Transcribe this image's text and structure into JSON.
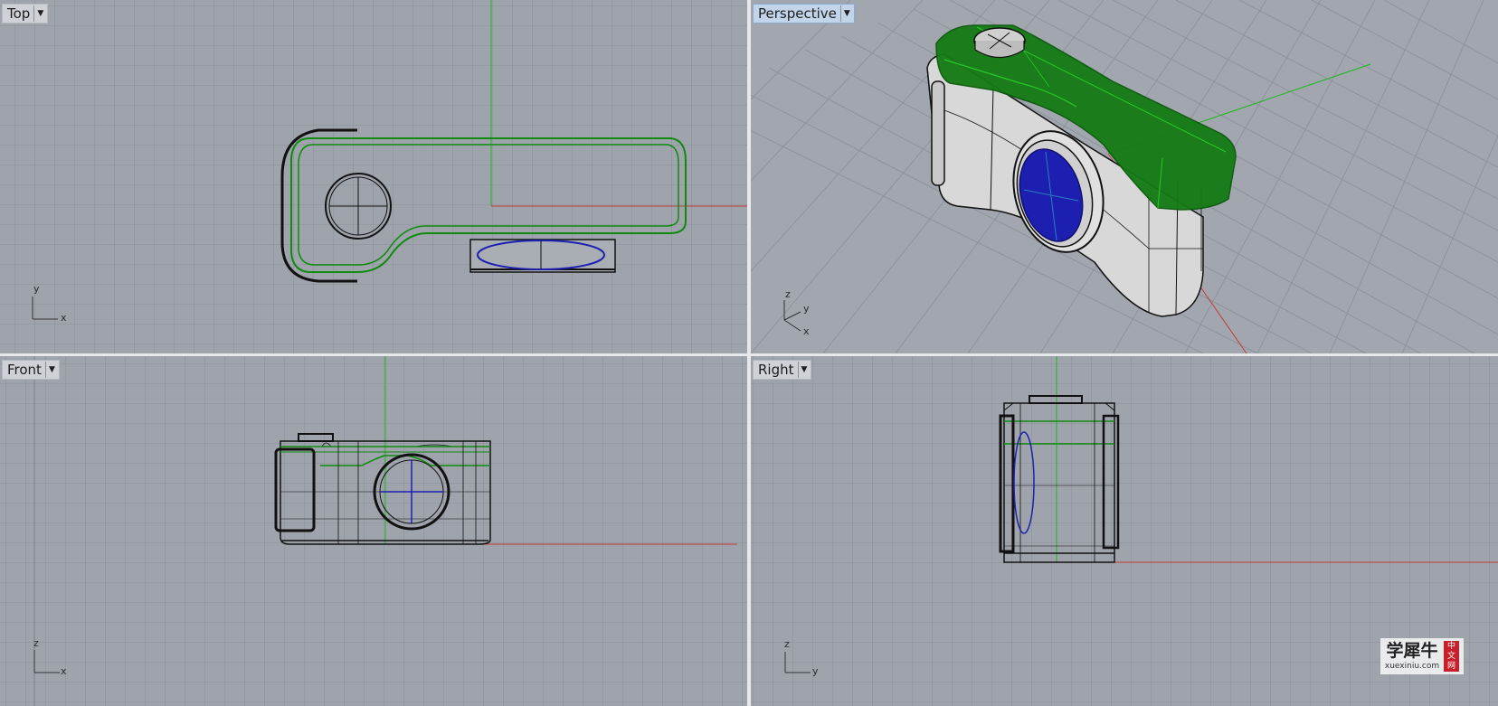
{
  "viewports": {
    "top": {
      "label": "Top",
      "axes": {
        "vertical": "y",
        "horizontal": "x"
      }
    },
    "perspective": {
      "label": "Perspective",
      "axes": {
        "vertical": "z",
        "mid": "y",
        "horizontal": "x"
      }
    },
    "front": {
      "label": "Front",
      "axes": {
        "vertical": "z",
        "horizontal": "x"
      }
    },
    "right": {
      "label": "Right",
      "axes": {
        "vertical": "z",
        "horizontal": "y"
      }
    }
  },
  "active_viewport": "perspective",
  "colors": {
    "viewport_bg": "#9ea3ab",
    "grid_line": "#8b9098",
    "grid_major": "#7a7f87",
    "x_axis": "#c23a3a",
    "y_axis": "#19b819",
    "selection": "#0f7a0f",
    "lens": "#1d1fb0",
    "body": "#e4e4e4",
    "wire": "#101010"
  },
  "icons": {
    "viewport_menu": "dropdown-arrow-icon"
  },
  "watermark": {
    "title": "学犀牛",
    "url": "xuexiniu.com",
    "badge": [
      "中",
      "文",
      "网"
    ]
  }
}
